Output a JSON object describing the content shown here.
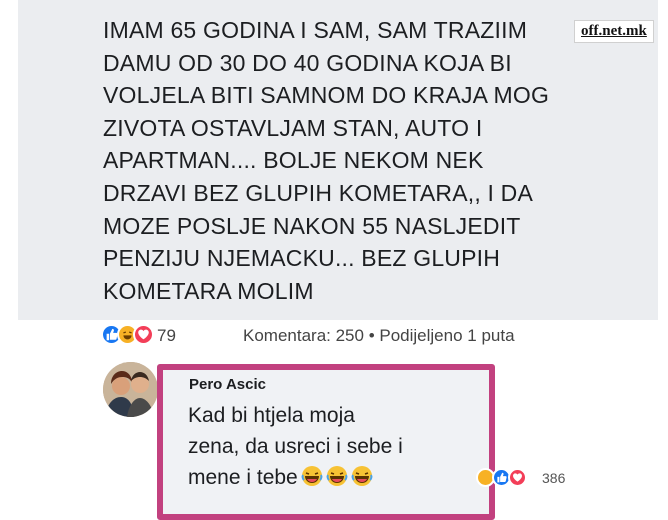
{
  "watermark": "off.net.mk",
  "post": {
    "lines": [
      "IMAM 65 GODINA I SAM, SAM TRAZIIM",
      "DAMU OD 30 DO 40 GODINA KOJA BI",
      "VOLJELA BITI SAMNOM DO KRAJA MOG",
      "ZIVOTA OSTAVLJAM STAN, AUTO I",
      "APARTMAN.... BOLJE NEKOM NEK",
      "DRZAVI BEZ GLUPIH KOMETARA,, I DA",
      "MOZE POSLJE NAKON 55 NASLJEDIT",
      "PENZIJU NJEMACKU... BEZ GLUPIH",
      "KOMETARA MOLIM"
    ]
  },
  "stats": {
    "reaction_count": "79",
    "comments_shares": "Komentara: 250 • Podijeljeno 1 puta",
    "reaction_icons": [
      "like-icon",
      "haha-icon",
      "love-icon"
    ]
  },
  "comment": {
    "author": "Pero Ascic",
    "lines": [
      "Kad bi htjela moja",
      "zena, da usreci i sebe i",
      "mene i tebe"
    ],
    "emoji": [
      "laughing-emoji",
      "laughing-emoji",
      "laughing-emoji"
    ],
    "reaction_count": "386"
  },
  "colors": {
    "like": "#1877f2",
    "haha": "#f7b125",
    "love": "#f33e58",
    "highlight_border": "#c2417f",
    "post_background": "#ebedf0"
  }
}
